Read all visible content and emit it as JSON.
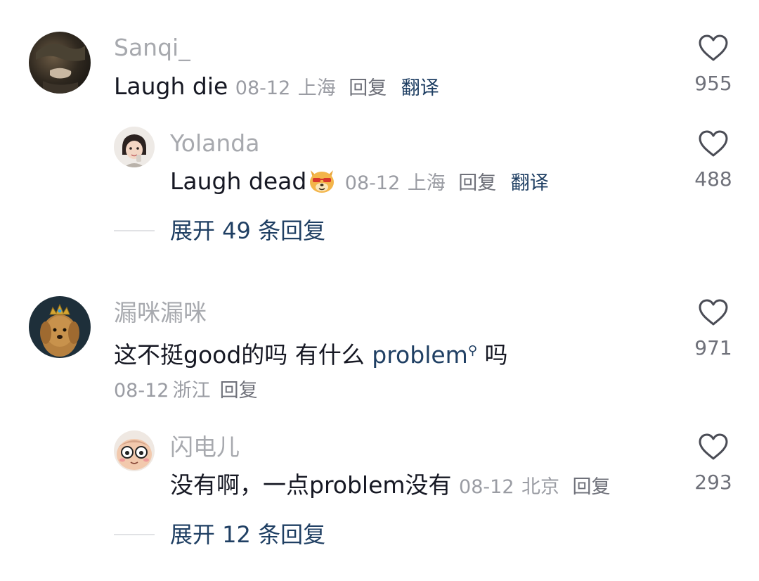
{
  "comments": [
    {
      "username": "Sanqi_",
      "text": "Laugh die",
      "date": "08-12",
      "location": "上海",
      "reply_label": "回复",
      "translate_label": "翻译",
      "likes": "955",
      "replies": [
        {
          "username": "Yolanda",
          "text": "Laugh dead",
          "emoji": "dog-emoji",
          "date": "08-12",
          "location": "上海",
          "reply_label": "回复",
          "translate_label": "翻译",
          "likes": "488"
        }
      ],
      "expand_label": "展开 49 条回复"
    },
    {
      "username": "漏咪漏咪",
      "text_before": "这不挺good的吗 有什么 ",
      "text_link": "problem",
      "text_after": " 吗",
      "date": "08-12",
      "location": "浙江",
      "reply_label": "回复",
      "likes": "971",
      "replies": [
        {
          "username": "闪电儿",
          "text": "没有啊，一点problem没有",
          "date": "08-12",
          "location": "北京",
          "reply_label": "回复",
          "likes": "293"
        }
      ],
      "expand_label": "展开 12 条回复"
    }
  ],
  "icons": {
    "like": "heart-outline-icon",
    "search_mini": "search-mini-icon"
  },
  "colors": {
    "username": "#a7a9ae",
    "text": "#161823",
    "meta": "#9a9ca3",
    "link": "#1f3f63",
    "heart": "#4a4c55"
  }
}
